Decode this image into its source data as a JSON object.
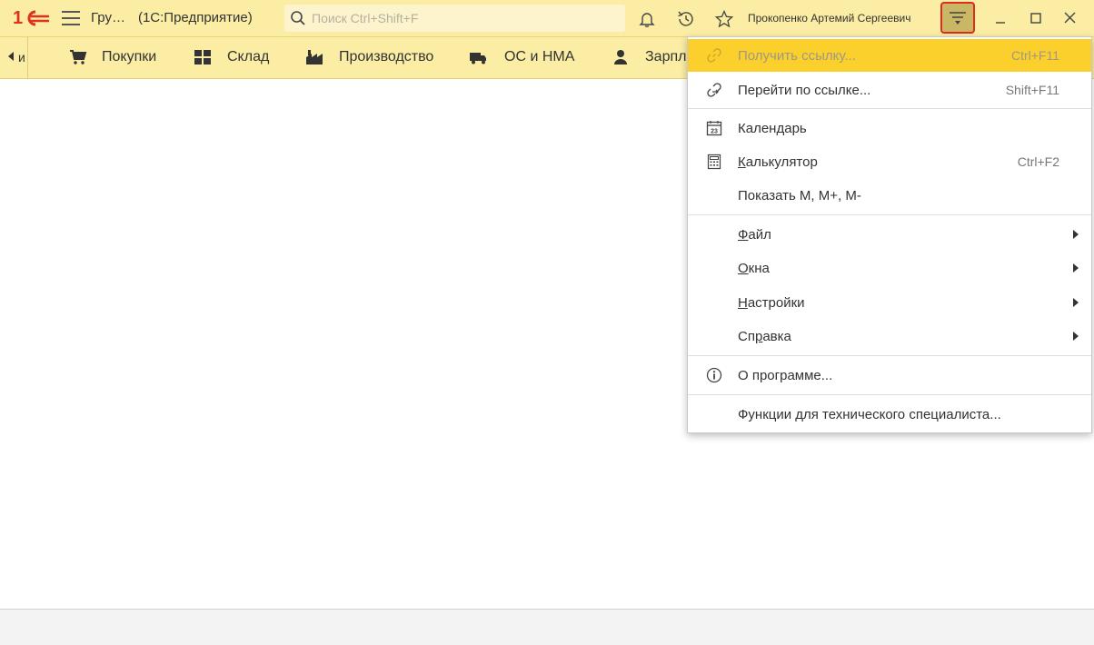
{
  "titlebar": {
    "logo_text": "1С",
    "title_short": "Гру…",
    "title_app": "(1С:Предприятие)",
    "search_placeholder": "Поиск Ctrl+Shift+F",
    "user_name": "Прокопенко Артемий Сергеевич"
  },
  "sections": {
    "left_tail": "и",
    "items": [
      {
        "label": "Покупки",
        "icon": "cart-icon"
      },
      {
        "label": "Склад",
        "icon": "warehouse-icon"
      },
      {
        "label": "Производство",
        "icon": "factory-icon"
      },
      {
        "label": "ОС и НМА",
        "icon": "truck-icon"
      },
      {
        "label": "Зарпл",
        "icon": "person-icon"
      }
    ]
  },
  "menu": {
    "items": [
      {
        "label": "Получить ссылку...",
        "shortcut": "Ctrl+F11",
        "icon": "link-icon",
        "state": "highlighted-disabled"
      },
      {
        "label": "Перейти по ссылке...",
        "shortcut": "Shift+F11",
        "icon": "go-link-icon"
      },
      {
        "label": "Календарь",
        "icon": "calendar-icon",
        "calendar_day": "23"
      },
      {
        "label": "Калькулятор",
        "shortcut": "Ctrl+F2",
        "icon": "calculator-icon"
      },
      {
        "label": "Показать М, М+, М-"
      },
      {
        "label": "Файл",
        "submenu": true
      },
      {
        "label": "Окна",
        "submenu": true
      },
      {
        "label": "Настройки",
        "submenu": true
      },
      {
        "label": "Справка",
        "submenu": true
      },
      {
        "label": "О программе...",
        "icon": "info-icon"
      },
      {
        "label": "Функции для технического специалиста..."
      }
    ]
  },
  "colors": {
    "titlebar_bg": "#fbeda4",
    "highlight": "#fcd02c",
    "logo_red": "#e0301e",
    "menu_button_border": "#e02b20"
  }
}
